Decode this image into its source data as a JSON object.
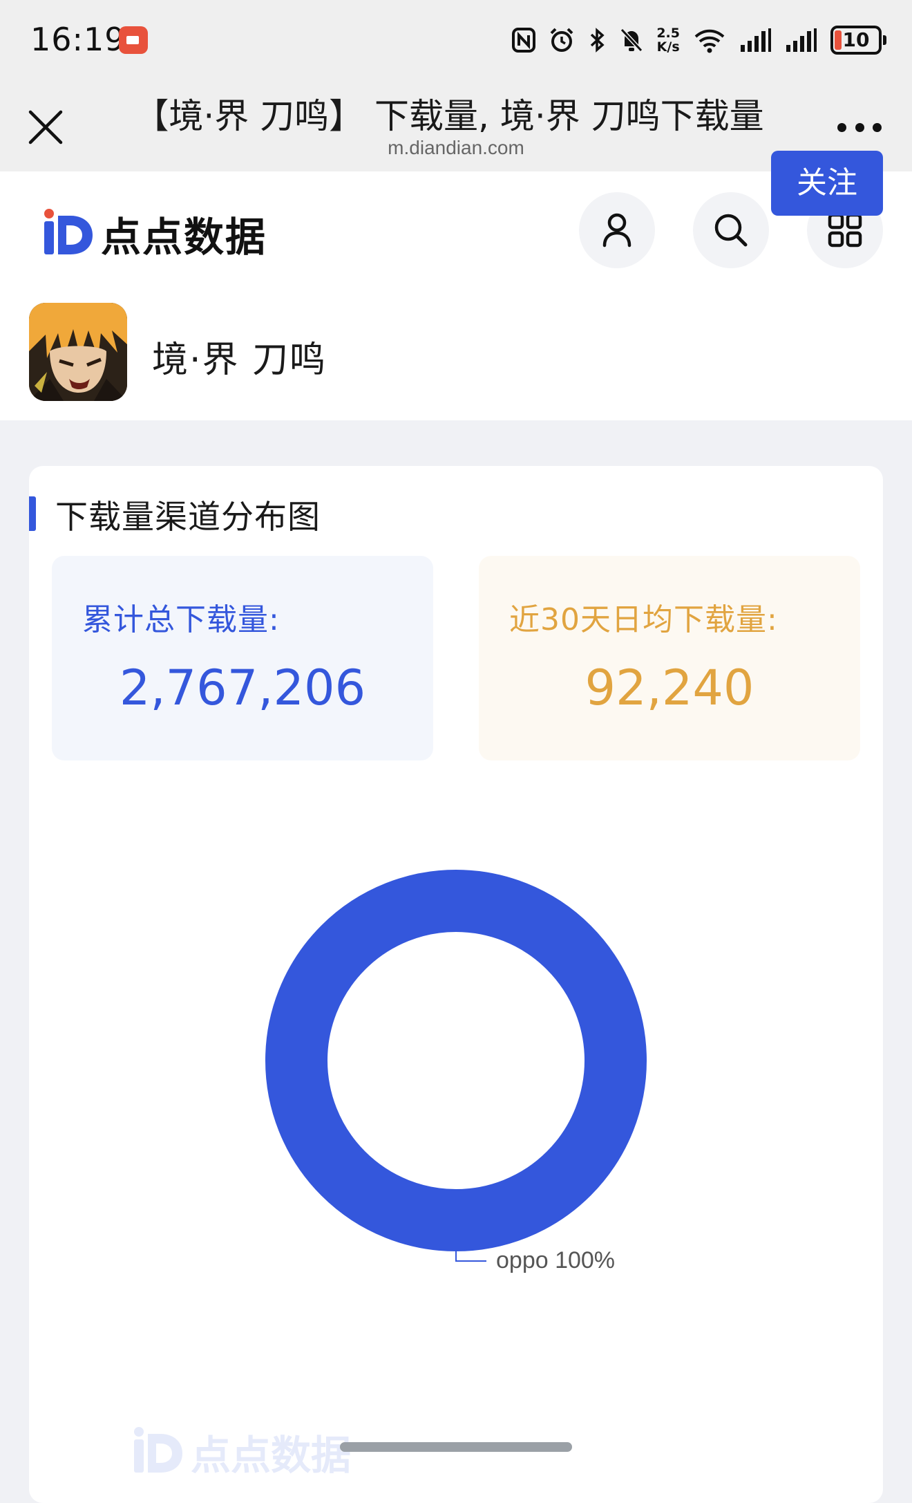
{
  "status_bar": {
    "time": "16:19",
    "net_speed_value": "2.5",
    "net_speed_unit": "K/s",
    "battery": "10",
    "icons": [
      "screen-record-icon",
      "nfc-icon",
      "alarm-icon",
      "bluetooth-icon",
      "mute-icon",
      "wifi-icon",
      "signal-icon",
      "signal-icon",
      "battery-icon"
    ]
  },
  "browser": {
    "title": "【境·界 刀鸣】 下载量, 境·界 刀鸣下载量",
    "url": "m.diandian.com"
  },
  "site": {
    "logo_text": "点点数据"
  },
  "app": {
    "name": "境·界 刀鸣",
    "follow_label": "关注"
  },
  "section": {
    "title": "下载量渠道分布图"
  },
  "stats": {
    "total_label": "累计总下载量:",
    "total_value": "2,767,206",
    "avg_label": "近30天日均下载量:",
    "avg_value": "92,240"
  },
  "colors": {
    "accent": "#3457dc",
    "orange": "#e1a440"
  },
  "chart_data": {
    "type": "pie",
    "donut": true,
    "title": "",
    "categories": [
      "oppo"
    ],
    "values": [
      100
    ],
    "labels": [
      "oppo 100%"
    ],
    "colors": [
      "#3457dc"
    ]
  }
}
